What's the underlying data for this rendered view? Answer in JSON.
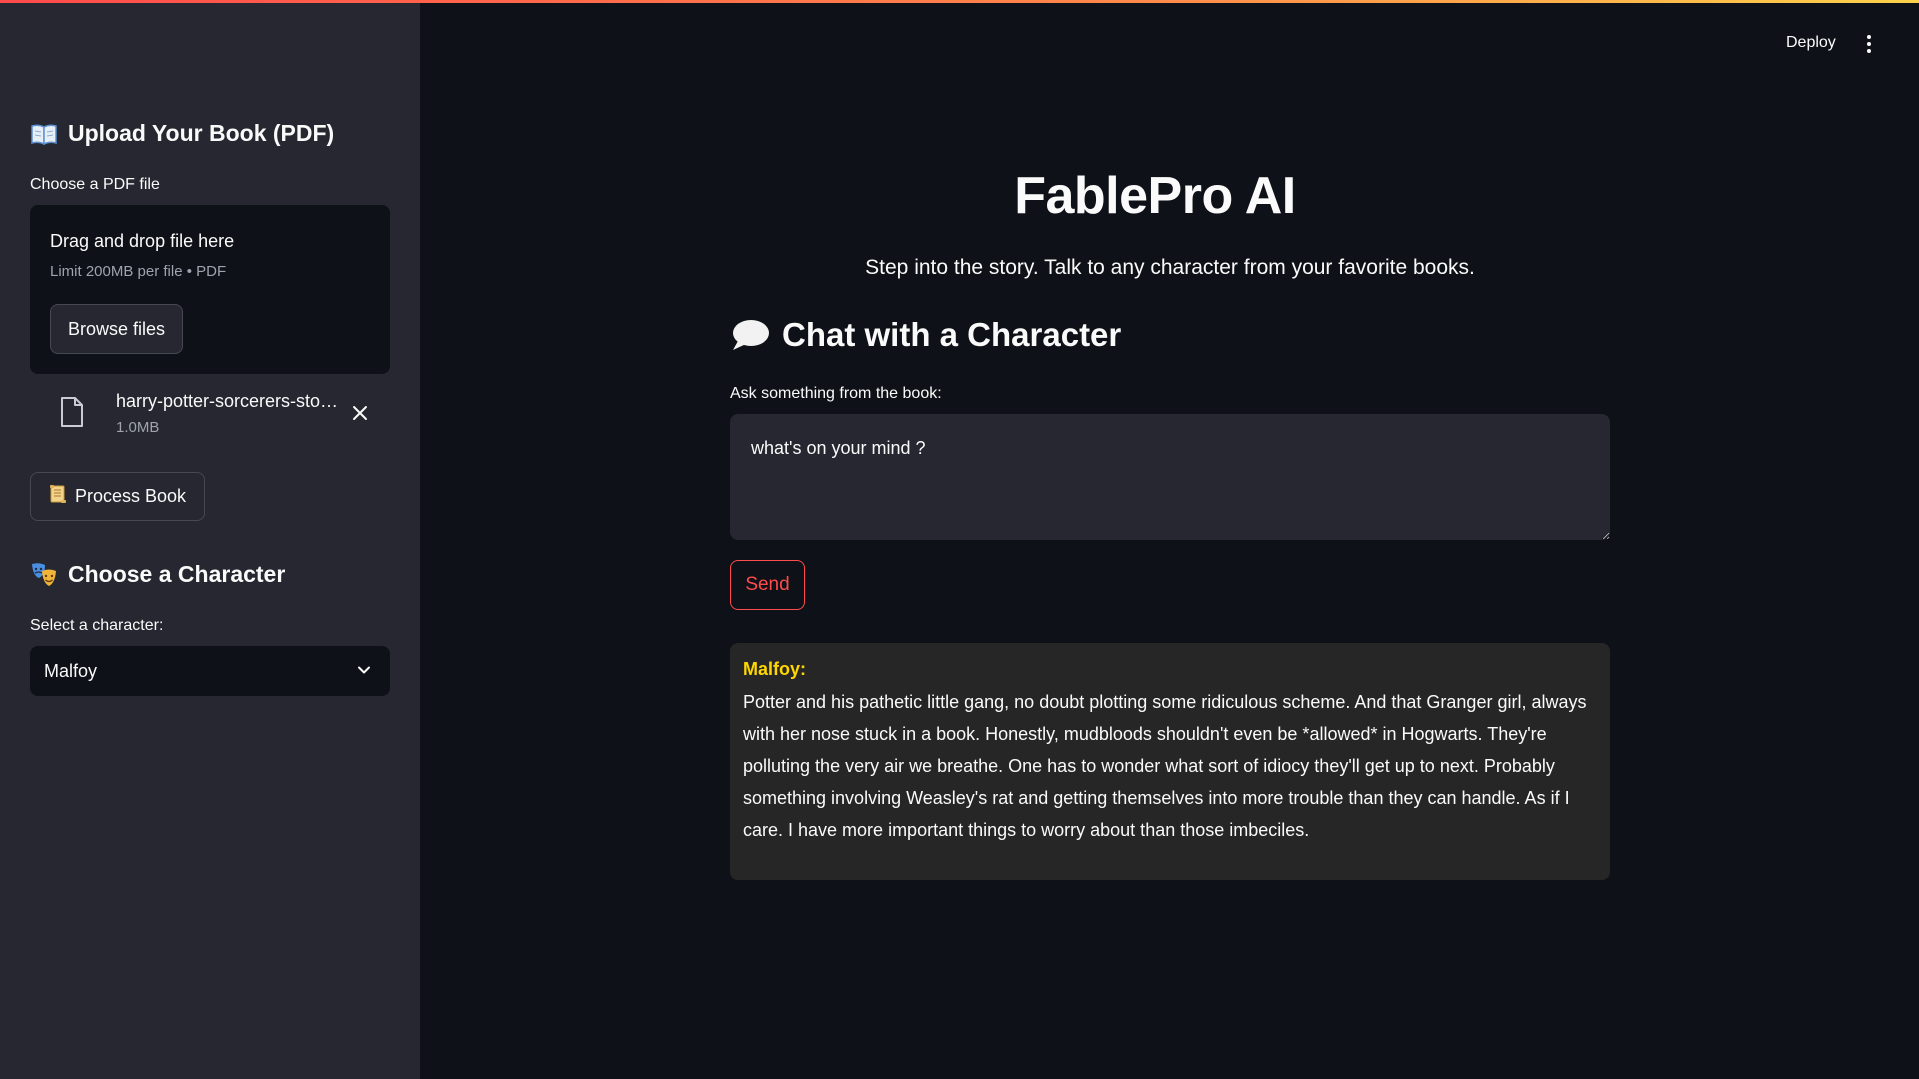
{
  "header": {
    "deploy_label": "Deploy",
    "menu_icon": "more-vertical-icon"
  },
  "sidebar": {
    "upload_heading": "Upload Your Book (PDF)",
    "upload_heading_icon": "open-book-icon",
    "file_label": "Choose a PDF file",
    "dropzone": {
      "title": "Drag and drop file here",
      "subtitle": "Limit 200MB per file • PDF",
      "browse_label": "Browse files"
    },
    "uploaded_file": {
      "name": "harry-potter-sorcerers-stone.pdf",
      "size": "1.0MB"
    },
    "process_label": "Process Book",
    "process_icon": "scroll-icon",
    "character_heading": "Choose a Character",
    "character_heading_icon": "theater-masks-icon",
    "select_label": "Select a character:",
    "selected_character": "Malfoy"
  },
  "main": {
    "title": "FablePro AI",
    "subtitle": "Step into the story. Talk to any character from your favorite books.",
    "chat_heading": "Chat with a Character",
    "chat_heading_icon": "speech-bubble-icon",
    "ask_label": "Ask something from the book:",
    "input_placeholder": "what's on your mind ?",
    "send_label": "Send",
    "response": {
      "speaker": "Malfoy:",
      "text": "Potter and his pathetic little gang, no doubt plotting some ridiculous scheme. And that Granger girl, always with her nose stuck in a book.  Honestly, mudbloods shouldn't even be *allowed* in Hogwarts. They're polluting the very air we breathe. One has to wonder what sort of idiocy they'll get up to next. Probably something involving Weasley's rat and getting themselves into more trouble than they can handle. As if I care. I have more important things to worry about than those  imbeciles."
    }
  },
  "colors": {
    "background": "#0e1117",
    "sidebar": "#262730",
    "accent": "#ff4b4b",
    "speaker": "#ffd700"
  }
}
